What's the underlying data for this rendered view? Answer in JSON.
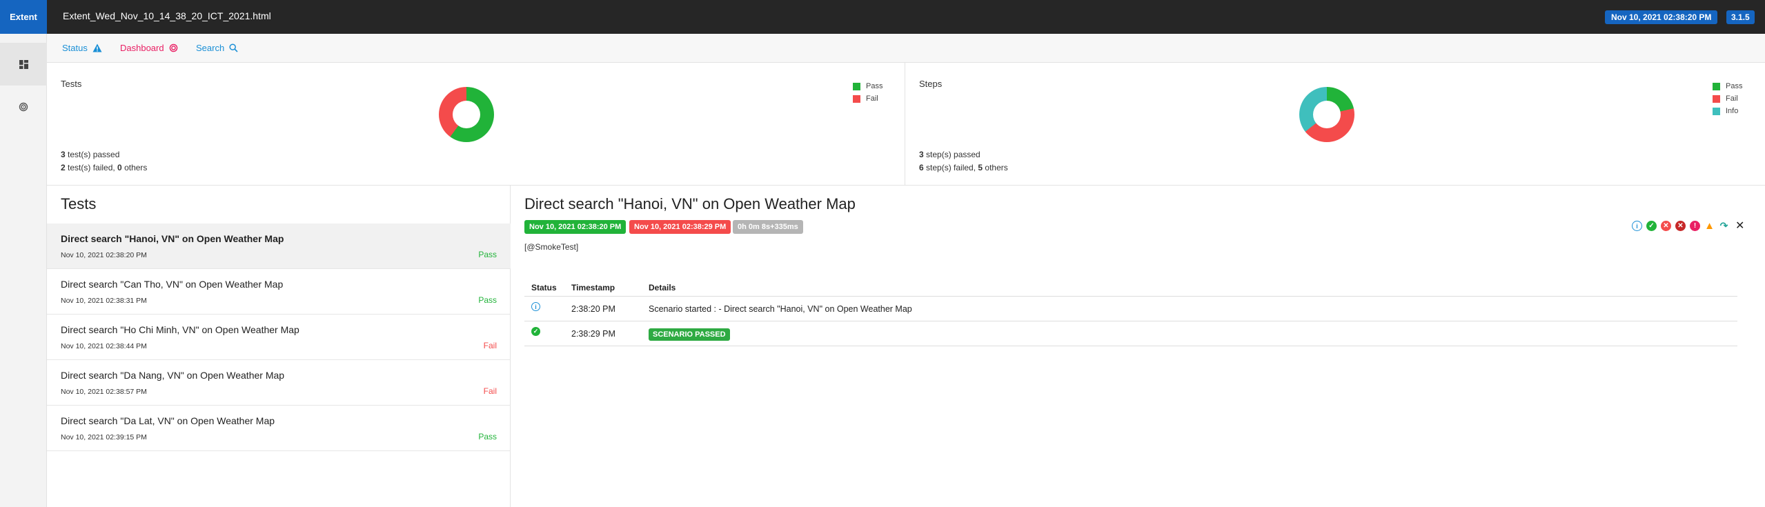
{
  "header": {
    "brand": "Extent",
    "report_name": "Extent_Wed_Nov_10_14_38_20_ICT_2021.html",
    "date_badge": "Nov 10, 2021 02:38:20 PM",
    "version_badge": "3.1.5"
  },
  "sidenav": {
    "items": [
      {
        "icon": "dashboard-grid-icon",
        "active": true
      },
      {
        "icon": "target-icon",
        "active": false
      }
    ]
  },
  "subnav": {
    "status_label": "Status",
    "dashboard_label": "Dashboard",
    "search_label": "Search"
  },
  "summary": {
    "tests": {
      "title": "Tests",
      "legend": [
        "Pass",
        "Fail"
      ],
      "chart_data": {
        "type": "pie",
        "categories": [
          "Pass",
          "Fail"
        ],
        "values": [
          3,
          2
        ],
        "colors": [
          "#21b339",
          "#f44b4b"
        ]
      },
      "passed_count": "3",
      "passed_text": " test(s) passed",
      "failed_count": "2",
      "failed_text": " test(s) failed, ",
      "others_count": "0",
      "others_text": " others"
    },
    "steps": {
      "title": "Steps",
      "legend": [
        "Pass",
        "Fail",
        "Info"
      ],
      "chart_data": {
        "type": "pie",
        "categories": [
          "Pass",
          "Fail",
          "Info"
        ],
        "values": [
          3,
          6,
          5
        ],
        "colors": [
          "#21b339",
          "#f44b4b",
          "#3fbfbd"
        ]
      },
      "passed_count": "3",
      "passed_text": " step(s) passed",
      "failed_count": "6",
      "failed_text": " step(s) failed, ",
      "others_count": "5",
      "others_text": " others"
    }
  },
  "tests_list": {
    "heading": "Tests",
    "items": [
      {
        "name": "Direct search \"Hanoi, VN\" on Open Weather Map",
        "time": "Nov 10, 2021 02:38:20 PM",
        "status": "Pass"
      },
      {
        "name": "Direct search \"Can Tho, VN\" on Open Weather Map",
        "time": "Nov 10, 2021 02:38:31 PM",
        "status": "Pass"
      },
      {
        "name": "Direct search \"Ho Chi Minh, VN\" on Open Weather Map",
        "time": "Nov 10, 2021 02:38:44 PM",
        "status": "Fail"
      },
      {
        "name": "Direct search \"Da Nang, VN\" on Open Weather Map",
        "time": "Nov 10, 2021 02:38:57 PM",
        "status": "Fail"
      },
      {
        "name": "Direct search \"Da Lat, VN\" on Open Weather Map",
        "time": "Nov 10, 2021 02:39:15 PM",
        "status": "Pass"
      }
    ]
  },
  "detail": {
    "title": "Direct search \"Hanoi, VN\" on Open Weather Map",
    "start_badge": "Nov 10, 2021 02:38:20 PM",
    "end_badge": "Nov 10, 2021 02:38:29 PM",
    "duration_badge": "0h 0m 8s+335ms",
    "tag": "[@SmokeTest]",
    "columns": {
      "status": "Status",
      "timestamp": "Timestamp",
      "details": "Details"
    },
    "logs": [
      {
        "status": "info",
        "timestamp": "2:38:20 PM",
        "details": "Scenario started : - Direct search \"Hanoi, VN\" on Open Weather Map"
      },
      {
        "status": "pass",
        "timestamp": "2:38:29 PM",
        "details": "SCENARIO PASSED"
      }
    ]
  },
  "colors": {
    "pass": "#21b339",
    "fail": "#f44b4b",
    "info": "#3fbfbd",
    "accent": "#1565c0",
    "dashboard": "#e91e63",
    "link": "#1a8fd6"
  }
}
